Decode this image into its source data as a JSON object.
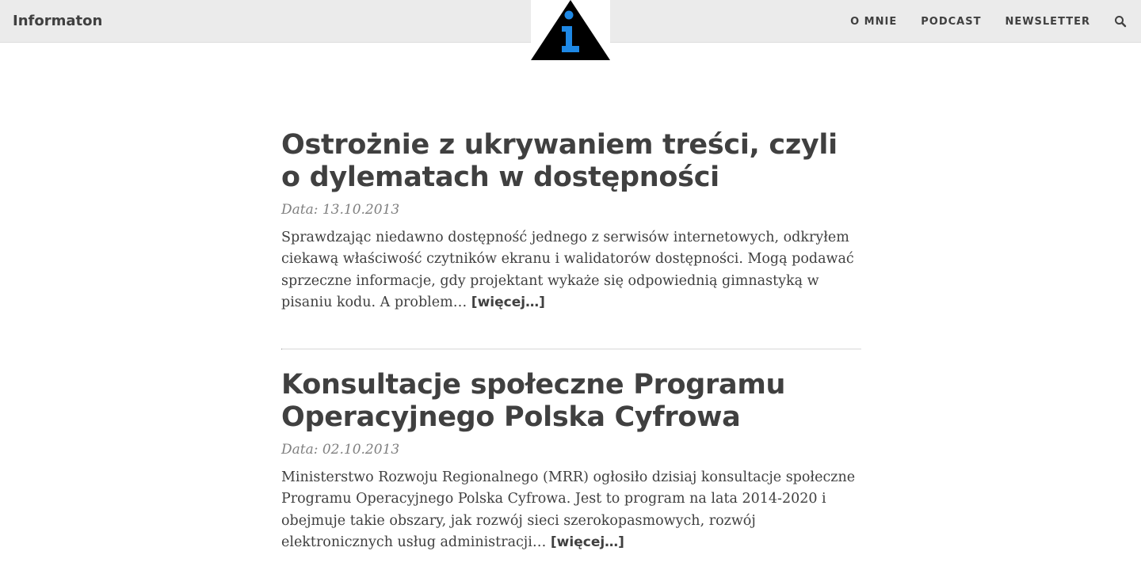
{
  "header": {
    "brand": "Informaton",
    "nav": [
      {
        "label": "O MNIE"
      },
      {
        "label": "PODCAST"
      },
      {
        "label": "NEWSLETTER"
      }
    ],
    "logo_colors": {
      "triangle": "#000000",
      "glyph": "#1e88e5"
    }
  },
  "posts": [
    {
      "title": "Ostrożnie z ukrywaniem treści, czyli o dylematach w dostępności",
      "date": "Data: 13.10.2013",
      "excerpt": "Sprawdzając niedawno dostępność jednego z serwisów internetowych, odkryłem ciekawą właściwość czytników ekranu i walidatorów dostępności. Mogą podawać sprzeczne informacje, gdy projektant wykaże się odpowiednią gimnastyką w pisaniu kodu. A problem…",
      "more": "[więcej…]"
    },
    {
      "title": "Konsultacje społeczne Programu Operacyjnego Polska Cyfrowa",
      "date": "Data: 02.10.2013",
      "excerpt": "Ministerstwo Rozwoju Regionalnego (MRR) ogłosiło dzisiaj konsultacje społeczne Programu Operacyjnego Polska Cyfrowa. Jest to program na lata 2014-2020 i obejmuje takie obszary, jak rozwój sieci szerokopasmowych, rozwój elektronicznych usług administracji…",
      "more": "[więcej…]"
    }
  ]
}
